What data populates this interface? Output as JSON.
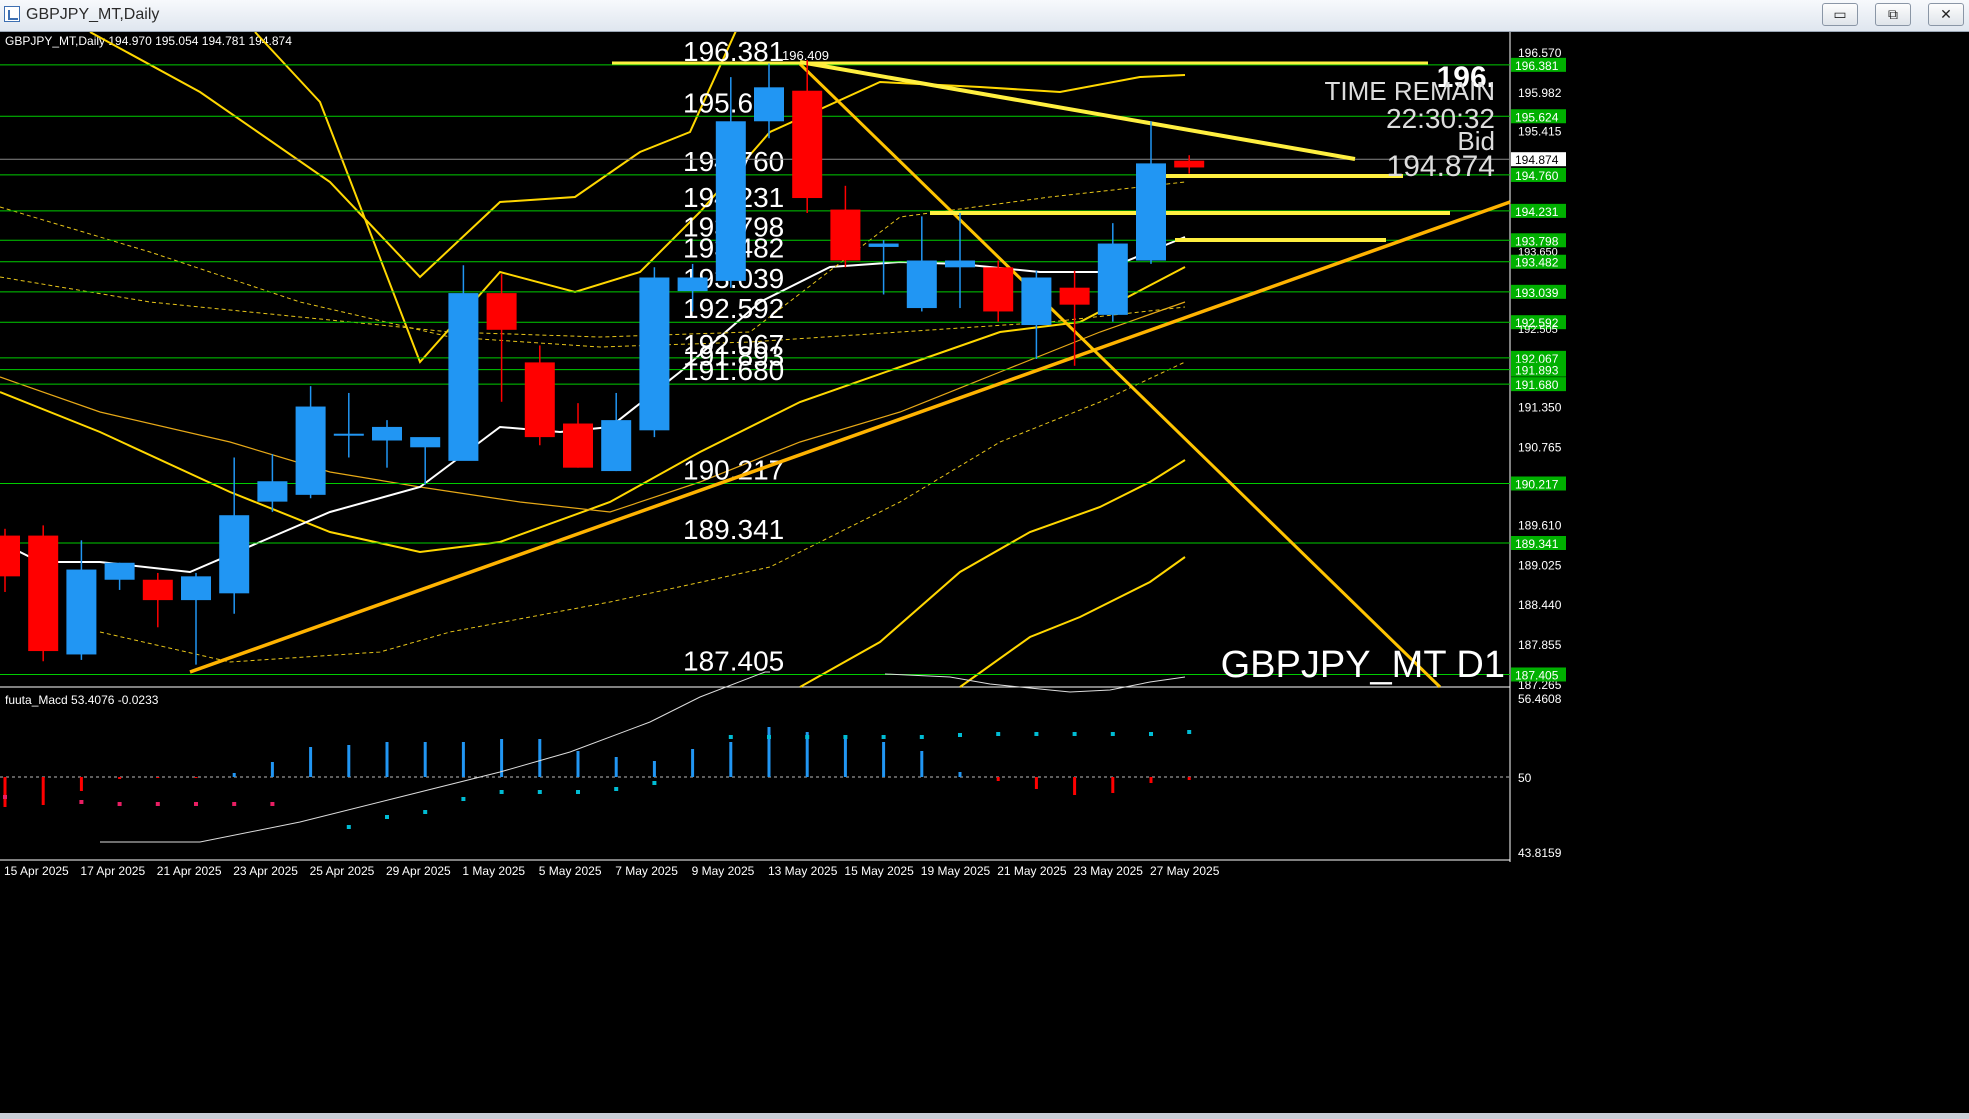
{
  "window": {
    "title": "GBPJPY_MT,Daily",
    "buttons": {
      "minimize": "▭",
      "restore": "⧉",
      "close": "✕"
    }
  },
  "chart_info": "GBPJPY_MT,Daily  194.970 195.054 194.781 194.874",
  "high_label": "196.409",
  "watermark": "GBPJPY_MT D1",
  "timer": {
    "price_big": "196.",
    "time_remain_label": "TIME REMAIN",
    "time": "22:30:32",
    "bid_label": "Bid",
    "bid_value": "194.874"
  },
  "price_axis": {
    "top": "196.570",
    "bottom": "187.265",
    "ticks": [
      "195.982",
      "195.415",
      "190.765",
      "191.350",
      "189.610",
      "189.025",
      "188.440",
      "187.855"
    ],
    "current": "194.874",
    "current_marker": "193.650",
    "dense_marker": "192.505"
  },
  "sr_levels": {
    "values": [
      "196.381",
      "195.624",
      "194.760",
      "194.231",
      "193.798",
      "193.482",
      "193.039",
      "192.592",
      "192.067",
      "191.893",
      "191.680",
      "190.217",
      "189.341",
      "187.405"
    ],
    "chart_labels": [
      "196.381",
      "195.624",
      "194.760",
      "194.231",
      "193.798",
      "193.482",
      "193.039",
      "192.592",
      "192.067",
      "191.893",
      "191.680",
      "190.217",
      "189.341",
      "187.405"
    ]
  },
  "macd": {
    "label": "fuuta_Macd 53.4076  -0.0233",
    "axis_top": "56.4608",
    "axis_mid": "50",
    "axis_bottom": "43.8159"
  },
  "time_axis": {
    "labels": [
      "15 Apr 2025",
      "17 Apr 2025",
      "21 Apr 2025",
      "23 Apr 2025",
      "25 Apr 2025",
      "29 Apr 2025",
      "1 May 2025",
      "5 May 2025",
      "7 May 2025",
      "9 May 2025",
      "13 May 2025",
      "15 May 2025",
      "19 May 2025",
      "21 May 2025",
      "23 May 2025",
      "27 May 2025"
    ]
  },
  "candles": [
    {
      "o": 189.45,
      "h": 189.55,
      "l": 188.62,
      "c": 188.85
    },
    {
      "o": 189.45,
      "h": 189.6,
      "l": 187.6,
      "c": 187.75
    },
    {
      "o": 187.7,
      "h": 189.38,
      "l": 187.62,
      "c": 188.95
    },
    {
      "o": 188.8,
      "h": 189.05,
      "l": 188.65,
      "c": 189.05
    },
    {
      "o": 188.8,
      "h": 188.9,
      "l": 188.1,
      "c": 188.5
    },
    {
      "o": 188.5,
      "h": 188.9,
      "l": 187.55,
      "c": 188.85
    },
    {
      "o": 188.6,
      "h": 190.6,
      "l": 188.3,
      "c": 189.75
    },
    {
      "o": 189.95,
      "h": 190.65,
      "l": 189.8,
      "c": 190.25
    },
    {
      "o": 190.05,
      "h": 191.65,
      "l": 190.0,
      "c": 191.35
    },
    {
      "o": 190.95,
      "h": 191.55,
      "l": 190.6,
      "c": 190.95
    },
    {
      "o": 190.85,
      "h": 191.15,
      "l": 190.45,
      "c": 191.05
    },
    {
      "o": 190.75,
      "h": 190.85,
      "l": 190.2,
      "c": 190.9
    },
    {
      "o": 190.55,
      "h": 193.43,
      "l": 190.6,
      "c": 193.02
    },
    {
      "o": 193.02,
      "h": 193.3,
      "l": 191.42,
      "c": 192.48
    },
    {
      "o": 192.0,
      "h": 192.25,
      "l": 190.78,
      "c": 190.9
    },
    {
      "o": 191.1,
      "h": 191.4,
      "l": 190.45,
      "c": 190.45
    },
    {
      "o": 190.4,
      "h": 191.55,
      "l": 190.4,
      "c": 191.15
    },
    {
      "o": 191.0,
      "h": 193.4,
      "l": 190.9,
      "c": 193.25
    },
    {
      "o": 193.05,
      "h": 193.45,
      "l": 192.75,
      "c": 193.25
    },
    {
      "o": 193.2,
      "h": 196.2,
      "l": 193.1,
      "c": 195.55
    },
    {
      "o": 195.55,
      "h": 196.4,
      "l": 195.3,
      "c": 196.05
    },
    {
      "o": 196.0,
      "h": 196.45,
      "l": 194.2,
      "c": 194.42
    },
    {
      "o": 194.25,
      "h": 194.6,
      "l": 193.4,
      "c": 193.5
    },
    {
      "o": 193.7,
      "h": 193.8,
      "l": 193.0,
      "c": 193.75
    },
    {
      "o": 192.8,
      "h": 194.15,
      "l": 192.75,
      "c": 193.5
    },
    {
      "o": 193.4,
      "h": 194.2,
      "l": 192.8,
      "c": 193.5
    },
    {
      "o": 193.4,
      "h": 193.5,
      "l": 192.6,
      "c": 192.75
    },
    {
      "o": 192.55,
      "h": 193.35,
      "l": 192.05,
      "c": 193.25
    },
    {
      "o": 193.1,
      "h": 193.35,
      "l": 191.95,
      "c": 192.85
    },
    {
      "o": 192.7,
      "h": 194.05,
      "l": 192.6,
      "c": 193.75
    },
    {
      "o": 193.5,
      "h": 195.55,
      "l": 193.45,
      "c": 194.93
    },
    {
      "o": 194.97,
      "h": 195.05,
      "l": 194.78,
      "c": 194.87
    }
  ],
  "colors": {
    "bull": "#2196f3",
    "bear": "#ff0000",
    "level": "#00cc00",
    "trendline": "#ffd700",
    "axis_text": "#ffffff",
    "axis_hl": "#00b000"
  }
}
